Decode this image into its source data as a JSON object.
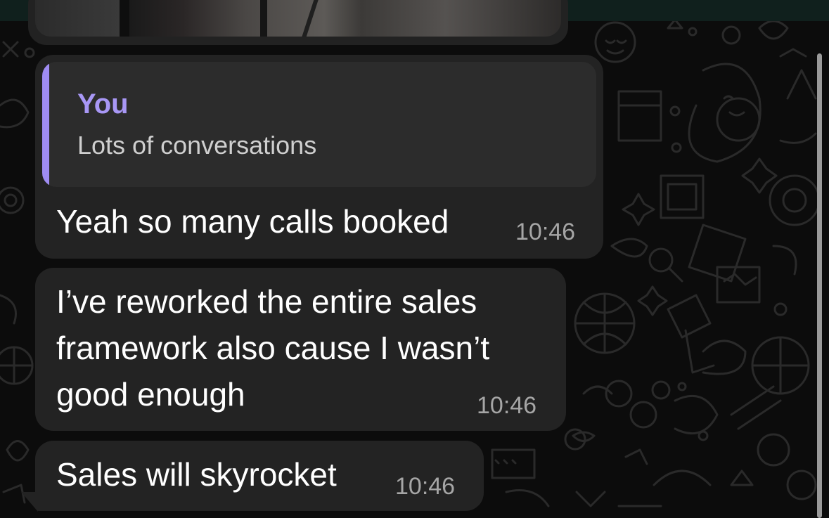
{
  "chat": {
    "reply_message": {
      "quoted_author": "You",
      "quoted_text": "Lots of conversations",
      "text": "Yeah so many calls booked",
      "time": "10:46"
    },
    "message_2": {
      "lines": [
        "I’ve reworked the entire sales",
        "framework also cause I wasn’t",
        "good enough"
      ],
      "time": "10:46"
    },
    "message_3": {
      "text": "Sales will skyrocket",
      "time": "10:46"
    }
  },
  "colors": {
    "bubble": "#232323",
    "quote_background": "#2c2c2c",
    "quote_accent": "#9f8cf2",
    "quote_author": "#a897f5",
    "timestamp": "#a6a6a6",
    "wallpaper": "#0c0c0c"
  },
  "icons": [
    "doodle-wallpaper-pattern",
    "scrollbar"
  ]
}
